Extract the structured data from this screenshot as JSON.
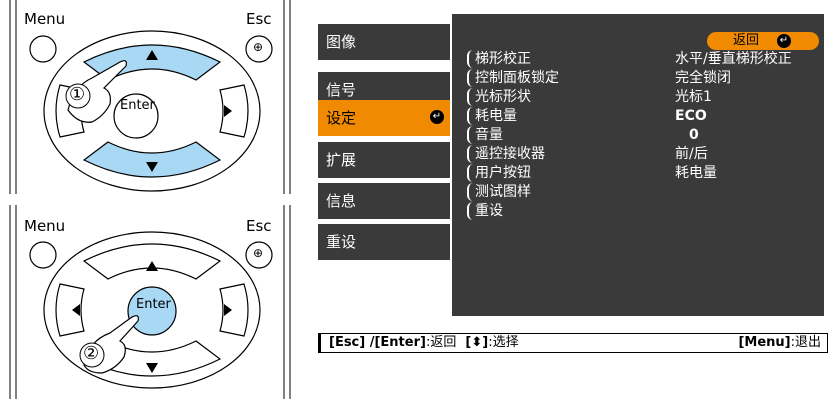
{
  "remote_top": {
    "menu_label": "Menu",
    "esc_label": "Esc",
    "enter_label": "Enter",
    "step": "①"
  },
  "remote_bottom": {
    "menu_label": "Menu",
    "esc_label": "Esc",
    "enter_label": "Enter",
    "step": "②"
  },
  "sidebar": {
    "items": [
      {
        "label": "图像"
      },
      {
        "label": "信号"
      },
      {
        "label": "设定"
      },
      {
        "label": "扩展"
      },
      {
        "label": "信息"
      },
      {
        "label": "重设"
      }
    ],
    "active_index": 2
  },
  "return_button": {
    "label": "返回"
  },
  "settings": [
    {
      "name": "梯形校正",
      "value": "水平/垂直梯形校正"
    },
    {
      "name": "控制面板锁定",
      "value": "完全锁闭"
    },
    {
      "name": "光标形状",
      "value": "光标1"
    },
    {
      "name": "耗电量",
      "value": "ECO"
    },
    {
      "name": "音量",
      "value": "0"
    },
    {
      "name": "遥控接收器",
      "value": "前/后"
    },
    {
      "name": "用户按钮",
      "value": "耗电量"
    },
    {
      "name": "测试图样",
      "value": ""
    },
    {
      "name": "重设",
      "value": ""
    }
  ],
  "guide": {
    "left_a": "[Esc] /[Enter]",
    "left_b": ":返回",
    "left_c": "[",
    "left_d": "]",
    "left_e": ":选择",
    "right_a": "[Menu]",
    "right_b": ":退出"
  },
  "colors": {
    "menu_bg": "#3a3a3a",
    "accent": "#f08a00",
    "highlight_arrow": "#a9d8f5"
  }
}
